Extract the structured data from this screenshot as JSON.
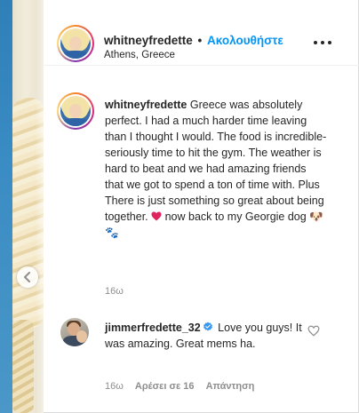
{
  "post": {
    "username": "whitneyfredette",
    "separator": "•",
    "follow_label": "Ακολουθήστε",
    "location": "Athens, Greece"
  },
  "caption": {
    "username": "whitneyfredette",
    "text_part1": " Greece was absolutely perfect. I had a much harder time leaving than I thought I would. The food is incredible- seriously time to hit the gym. The weather is hard to beat and we had amazing friends that we got to spend a ton of time with. Plus There is just something so great about being together. ",
    "text_part2": " now back to my Georgie dog 🐶🐾",
    "time": "16ω"
  },
  "comment": {
    "username": "jimmerfredette_32",
    "text": " Love you guys! It was amazing. Great mems ha.",
    "time": "16ω",
    "likes": "Αρέσει σε 16",
    "reply_label": "Απάντηση"
  },
  "icons": {
    "more": "more-options-icon",
    "prev": "chevron-left-icon",
    "verified": "verified-badge-icon",
    "heart_emoji": "red-heart-emoji",
    "like": "heart-outline-icon"
  },
  "colors": {
    "link_blue": "#0095f6",
    "text": "#262626",
    "secondary": "#8e8e8e",
    "verified_blue": "#3897f0",
    "heart_red": "#e0245e"
  }
}
